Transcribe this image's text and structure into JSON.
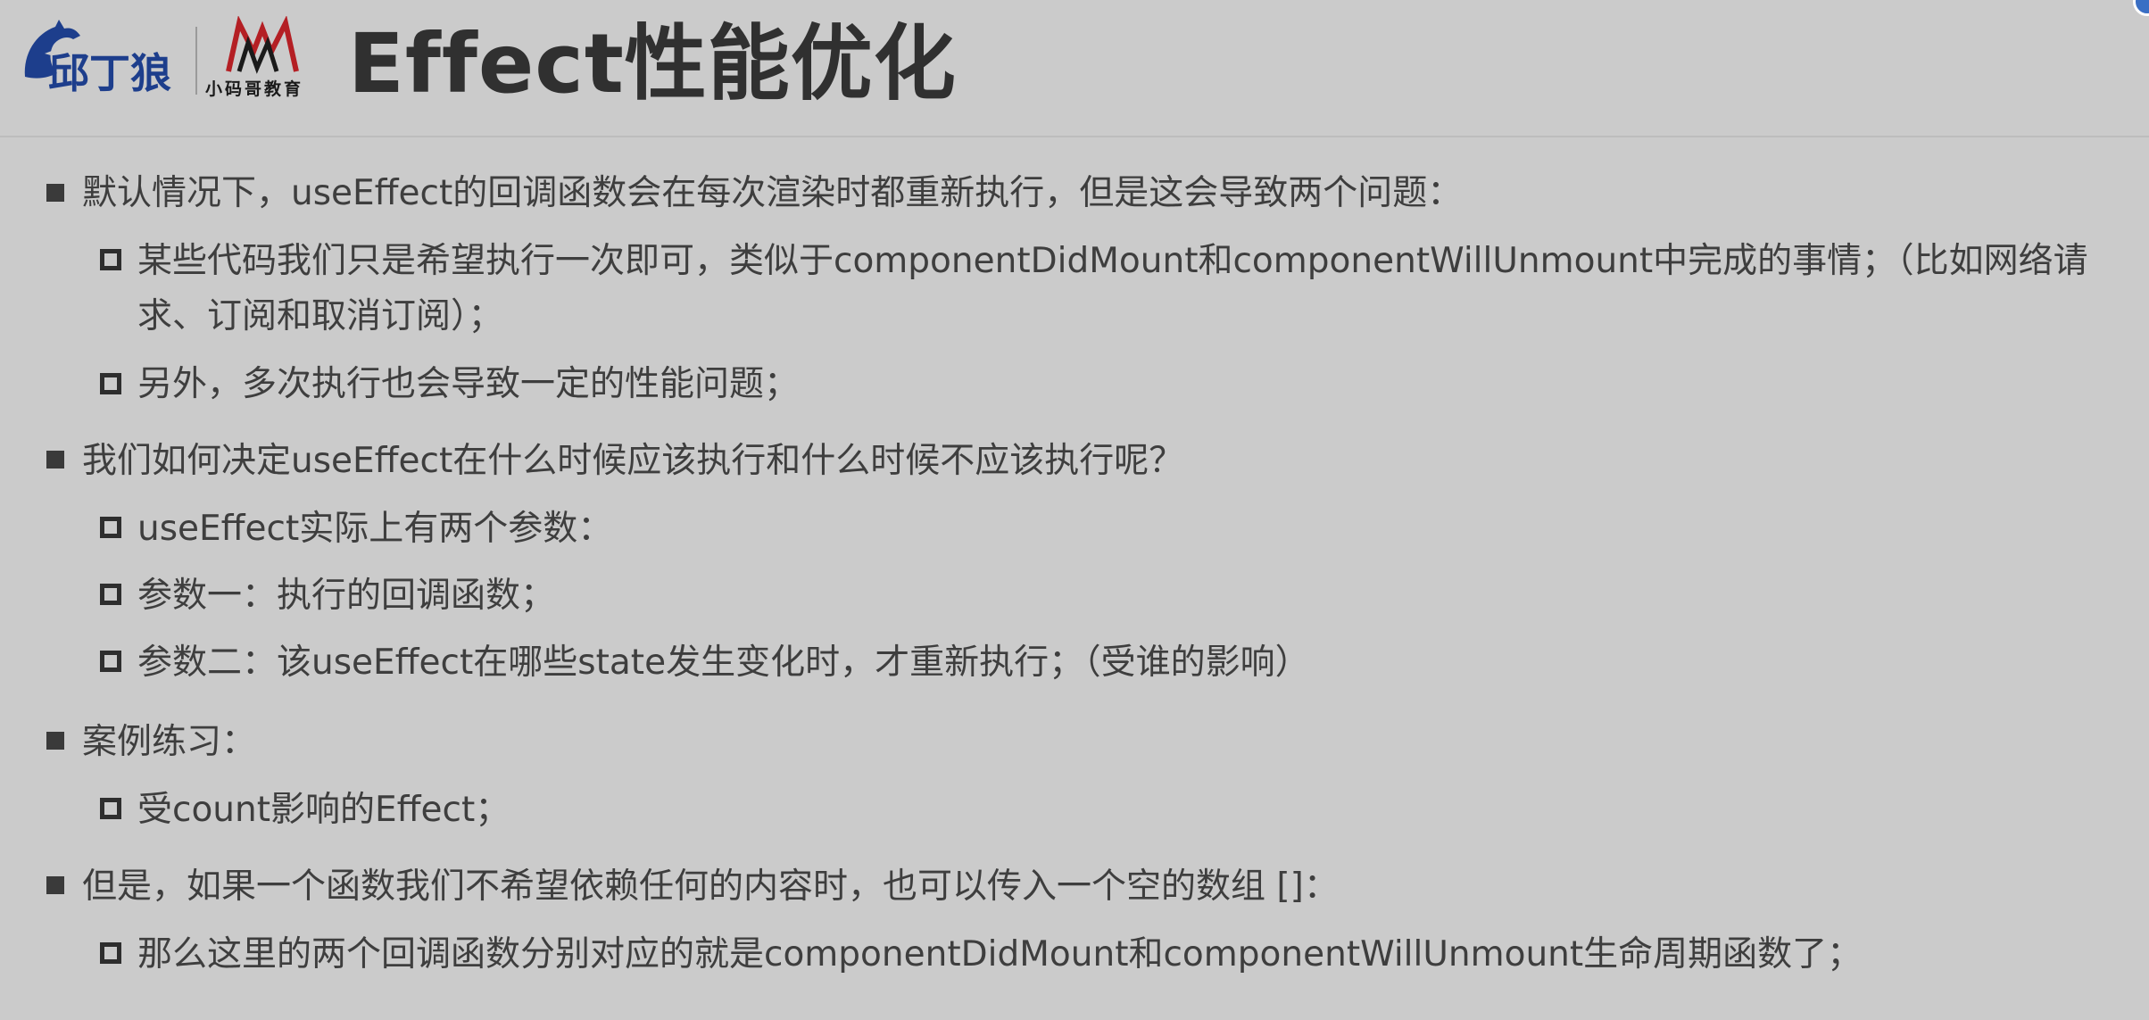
{
  "header": {
    "title": "Effect性能优化",
    "logo_left_text": "邱丁狼",
    "logo_right_caption": "小码哥教育"
  },
  "bullets": [
    {
      "text": "默认情况下，useEffect的回调函数会在每次渲染时都重新执行，但是这会导致两个问题：",
      "children": [
        "某些代码我们只是希望执行一次即可，类似于componentDidMount和componentWillUnmount中完成的事情；（比如网络请求、订阅和取消订阅）；",
        "另外，多次执行也会导致一定的性能问题；"
      ]
    },
    {
      "text": "我们如何决定useEffect在什么时候应该执行和什么时候不应该执行呢？",
      "children": [
        "useEffect实际上有两个参数：",
        "参数一：执行的回调函数；",
        "参数二：该useEffect在哪些state发生变化时，才重新执行；（受谁的影响）"
      ]
    },
    {
      "text": "案例练习：",
      "children": [
        "受count影响的Effect；"
      ]
    },
    {
      "text": "但是，如果一个函数我们不希望依赖任何的内容时，也可以传入一个空的数组 []：",
      "children": [
        "那么这里的两个回调函数分别对应的就是componentDidMount和componentWillUnmount生命周期函数了；"
      ]
    }
  ],
  "colors": {
    "background": "#cbcbcb",
    "text": "#3e3e3e",
    "title": "#303030",
    "logo_blue": "#1d3e8c",
    "logo_red": "#b41f24"
  }
}
